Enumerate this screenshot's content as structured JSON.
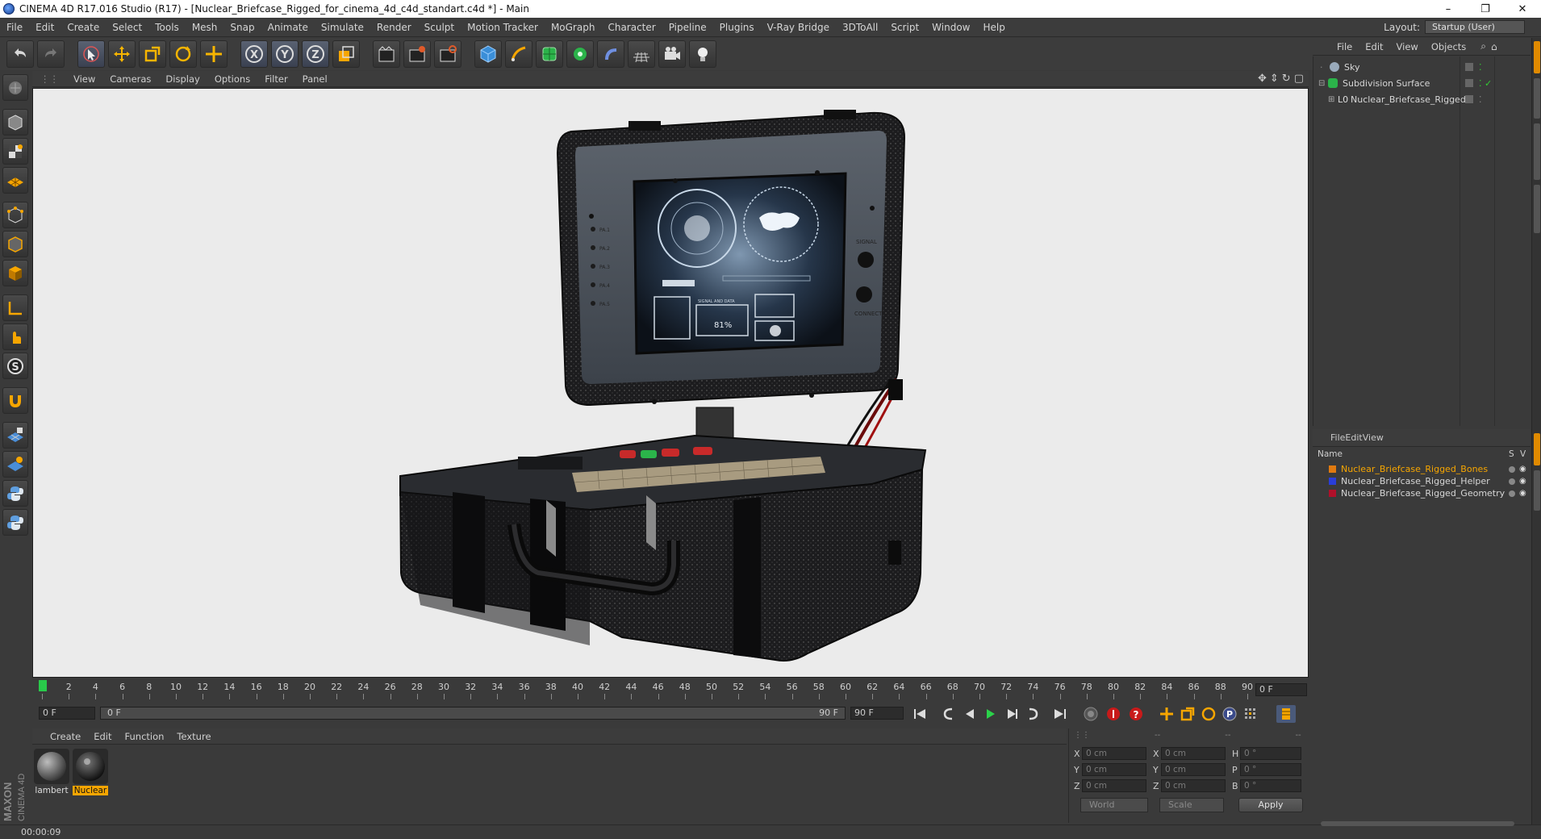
{
  "window": {
    "title": "CINEMA 4D R17.016 Studio (R17) - [Nuclear_Briefcase_Rigged_for_cinema_4d_c4d_standart.c4d *] - Main",
    "controls": [
      "–",
      "❐",
      "✕"
    ]
  },
  "menubar": {
    "items": [
      "File",
      "Edit",
      "Create",
      "Select",
      "Tools",
      "Mesh",
      "Snap",
      "Animate",
      "Simulate",
      "Render",
      "Sculpt",
      "Motion Tracker",
      "MoGraph",
      "Character",
      "Pipeline",
      "Plugins",
      "V-Ray Bridge",
      "3DToAll",
      "Script",
      "Window",
      "Help"
    ],
    "layout_label": "Layout:",
    "layout_value": "Startup (User)"
  },
  "toolbar": {
    "icons": [
      "undo-icon",
      "redo-icon",
      "live-selection-icon",
      "move-icon",
      "scale-icon",
      "rotate-icon",
      "transform-icon",
      "x-axis-icon",
      "y-axis-icon",
      "z-axis-icon",
      "coordinate-system-icon",
      "render-view-icon",
      "render-picture-viewer-icon",
      "render-settings-icon",
      "cube-icon",
      "pen-icon",
      "subdivision-icon",
      "mograph-cloner-icon",
      "deformer-icon",
      "floor-icon",
      "camera-icon",
      "light-icon"
    ],
    "axis_labels": [
      "X",
      "Y",
      "Z"
    ]
  },
  "lefttoolbar": {
    "icons": [
      "make-editable-icon",
      "model-mode-icon",
      "texture-mode-icon",
      "workplane-icon",
      "points-mode-icon",
      "edges-mode-icon",
      "polygons-mode-icon",
      "axis-mode-icon",
      "tweak-mode-icon",
      "snap-icon",
      "magnet-icon",
      "workplane-lock-icon",
      "solo-icon",
      "python-icon",
      "python-script-icon"
    ]
  },
  "viewport": {
    "menu": [
      "View",
      "Cameras",
      "Display",
      "Options",
      "Filter",
      "Panel"
    ],
    "nav_icons": [
      "move-view-icon",
      "zoom-view-icon",
      "rotate-view-icon",
      "toggle-view-icon"
    ],
    "model": {
      "left_labels": [
        "PA.1",
        "PA.2",
        "PA.3",
        "PA.4",
        "PA.5"
      ],
      "right_labels": [
        "SIGNAL",
        "CONNECT"
      ],
      "screen_percent": "81%",
      "screen_caption": "SIGNAL AND DATA"
    }
  },
  "timeline": {
    "ticks": [
      "0",
      "2",
      "4",
      "6",
      "8",
      "10",
      "12",
      "14",
      "16",
      "18",
      "20",
      "22",
      "24",
      "26",
      "28",
      "30",
      "32",
      "34",
      "36",
      "38",
      "40",
      "42",
      "44",
      "46",
      "48",
      "50",
      "52",
      "54",
      "56",
      "58",
      "60",
      "62",
      "64",
      "66",
      "68",
      "70",
      "72",
      "74",
      "76",
      "78",
      "80",
      "82",
      "84",
      "86",
      "88",
      "90"
    ],
    "current_frame": "0 F",
    "start_frame": "0 F",
    "range_start": "0 F",
    "range_end": "90 F",
    "end_frame": "90 F"
  },
  "transport": {
    "icons": [
      "go-to-start-icon",
      "previous-key-icon",
      "play-backwards-icon",
      "play-forwards-icon",
      "next-key-icon",
      "loop-icon",
      "go-to-end-icon",
      "record-icon",
      "auto-key-icon",
      "keyframe-help-icon",
      "move-key-icon",
      "scale-key-icon",
      "rotate-key-icon",
      "param-key-icon",
      "pla-key-icon",
      "timeline-icon"
    ]
  },
  "material_manager": {
    "menu": [
      "Create",
      "Edit",
      "Function",
      "Texture"
    ],
    "materials": [
      {
        "name": "lambert",
        "active": false
      },
      {
        "name": "Nuclear",
        "active": true
      }
    ]
  },
  "coordinates": {
    "header": [
      "--",
      "--",
      "--"
    ],
    "rows": [
      {
        "a": "X",
        "v1": "0 cm",
        "b": "X",
        "v2": "0 cm",
        "c": "H",
        "v3": "0 °"
      },
      {
        "a": "Y",
        "v1": "0 cm",
        "b": "Y",
        "v2": "0 cm",
        "c": "P",
        "v3": "0 °"
      },
      {
        "a": "Z",
        "v1": "0 cm",
        "b": "Z",
        "v2": "0 cm",
        "c": "B",
        "v3": "0 °"
      }
    ],
    "mode": "World",
    "type": "Scale",
    "apply": "Apply"
  },
  "object_manager": {
    "menu": [
      "File",
      "Edit",
      "View",
      "Objects"
    ],
    "objects": [
      {
        "name": "Sky",
        "icon": "sky-icon"
      },
      {
        "name": "Subdivision Surface",
        "icon": "subdivision-icon"
      },
      {
        "name": "Nuclear_Briefcase_Rigged",
        "icon": "null-object-icon"
      }
    ]
  },
  "layer_manager": {
    "menu": [
      "File",
      "Edit",
      "View"
    ],
    "columns": {
      "name": "Name",
      "s": "S",
      "v": "V"
    },
    "layers": [
      {
        "name": "Nuclear_Briefcase_Rigged_Bones",
        "color": "#e07a10",
        "active": true
      },
      {
        "name": "Nuclear_Briefcase_Rigged_Helper",
        "color": "#2a3ed8",
        "active": false
      },
      {
        "name": "Nuclear_Briefcase_Rigged_Geometry",
        "color": "#b0102a",
        "active": false
      }
    ]
  },
  "status": {
    "text": "00:00:09"
  },
  "brand": {
    "maxon": "MAXON",
    "cinema": "CINEMA 4D"
  },
  "colors": {
    "accent": "#f7a600",
    "playhead": "#29c94a",
    "background": "#3a3a3a"
  }
}
